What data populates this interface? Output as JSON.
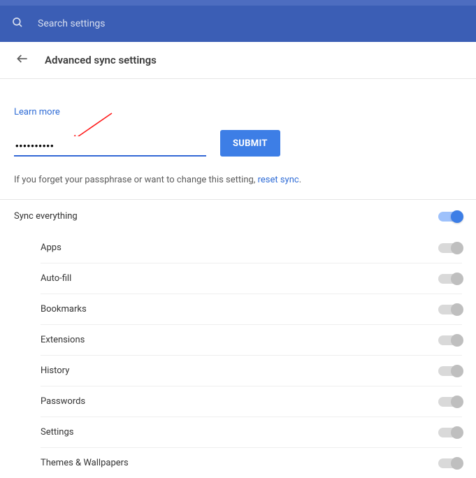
{
  "search": {
    "placeholder": "Search settings"
  },
  "header": {
    "title": "Advanced sync settings"
  },
  "learn_more_label": "Learn more",
  "passphrase_value": "••••••••••",
  "submit_label": "SUBMIT",
  "forget_text_prefix": "If you forget your passphrase or want to change this setting, ",
  "forget_text_link": "reset sync",
  "forget_text_suffix": ".",
  "sync_master": {
    "label": "Sync everything",
    "on": true
  },
  "sync_items": [
    {
      "label": "Apps",
      "on": false
    },
    {
      "label": "Auto-fill",
      "on": false
    },
    {
      "label": "Bookmarks",
      "on": false
    },
    {
      "label": "Extensions",
      "on": false
    },
    {
      "label": "History",
      "on": false
    },
    {
      "label": "Passwords",
      "on": false
    },
    {
      "label": "Settings",
      "on": false
    },
    {
      "label": "Themes & Wallpapers",
      "on": false
    }
  ]
}
